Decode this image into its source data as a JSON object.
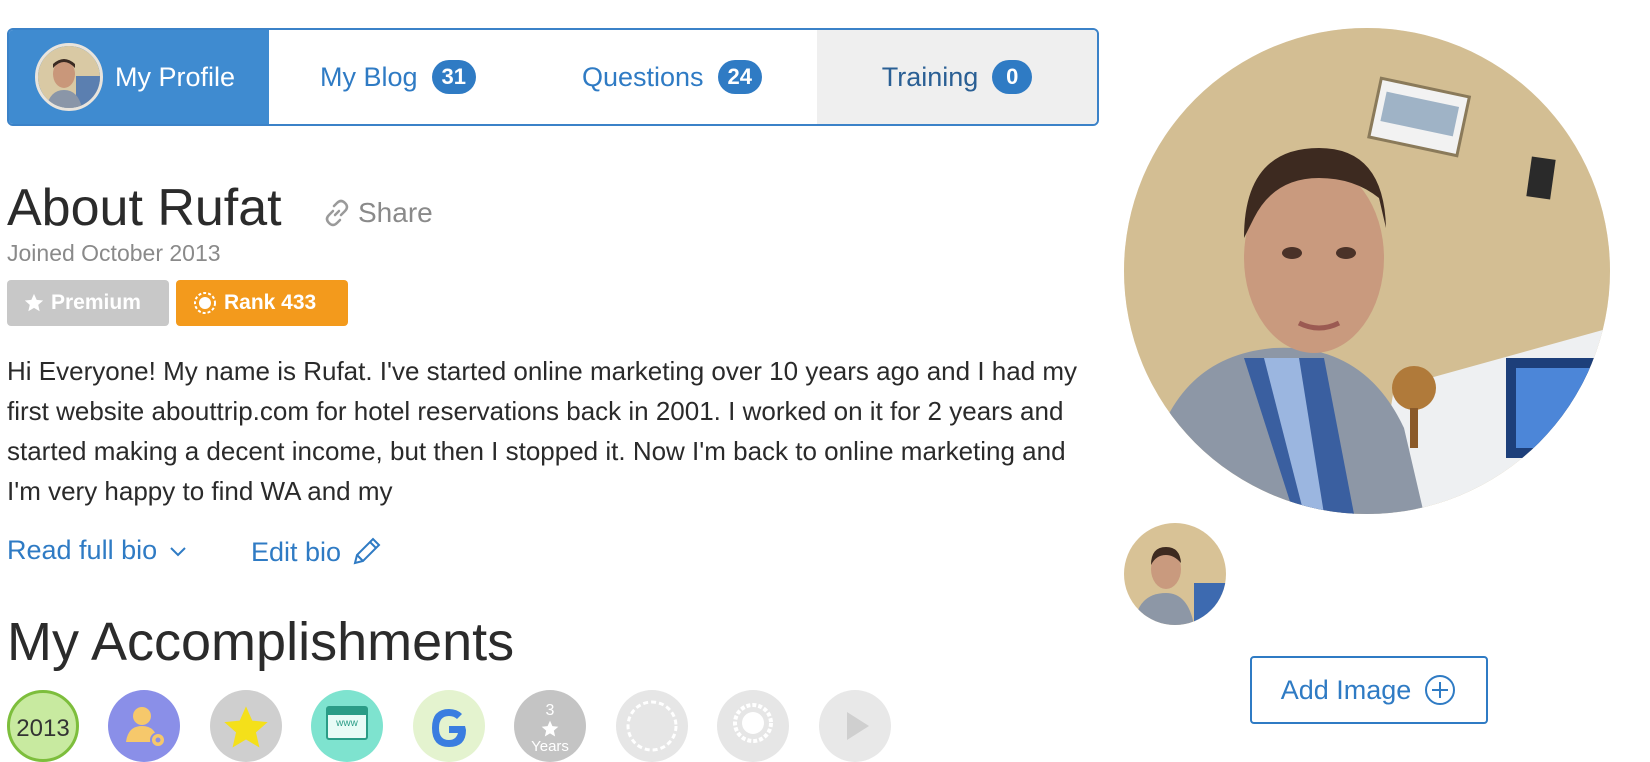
{
  "tabs": {
    "profile": "My Profile",
    "blog": "My Blog",
    "blog_count": "31",
    "questions": "Questions",
    "questions_count": "24",
    "training": "Training",
    "training_count": "0"
  },
  "about": {
    "title": "About Rufat",
    "share": "Share",
    "joined": "Joined October 2013"
  },
  "badges": {
    "premium": "Premium",
    "rank": "Rank 433"
  },
  "bio": {
    "text": "Hi Everyone! My name is Rufat. I've started online marketing over 10 years ago and I had my first website abouttrip.com for hotel reservations back in 2001. I worked on it for 2 years and started making a decent income, but then I stopped it. Now I'm back to online marketing and I'm very happy to find WA and my",
    "read_more": "Read full bio",
    "edit": "Edit bio"
  },
  "accomplishments": {
    "title": "My Accomplishments",
    "medal_year": "2013",
    "medal_years_count": "3",
    "medal_years_label": "Years",
    "medal_www": "www"
  },
  "sidebar": {
    "add_image": "Add Image"
  },
  "colors": {
    "accent": "#2f7bc4",
    "rank": "#f39a1c",
    "premium": "#c8c8c8"
  },
  "icons": [
    "share-link-icon",
    "star-icon",
    "rank-icon",
    "chevron-down-icon",
    "pencil-icon",
    "plus-circle-icon"
  ]
}
